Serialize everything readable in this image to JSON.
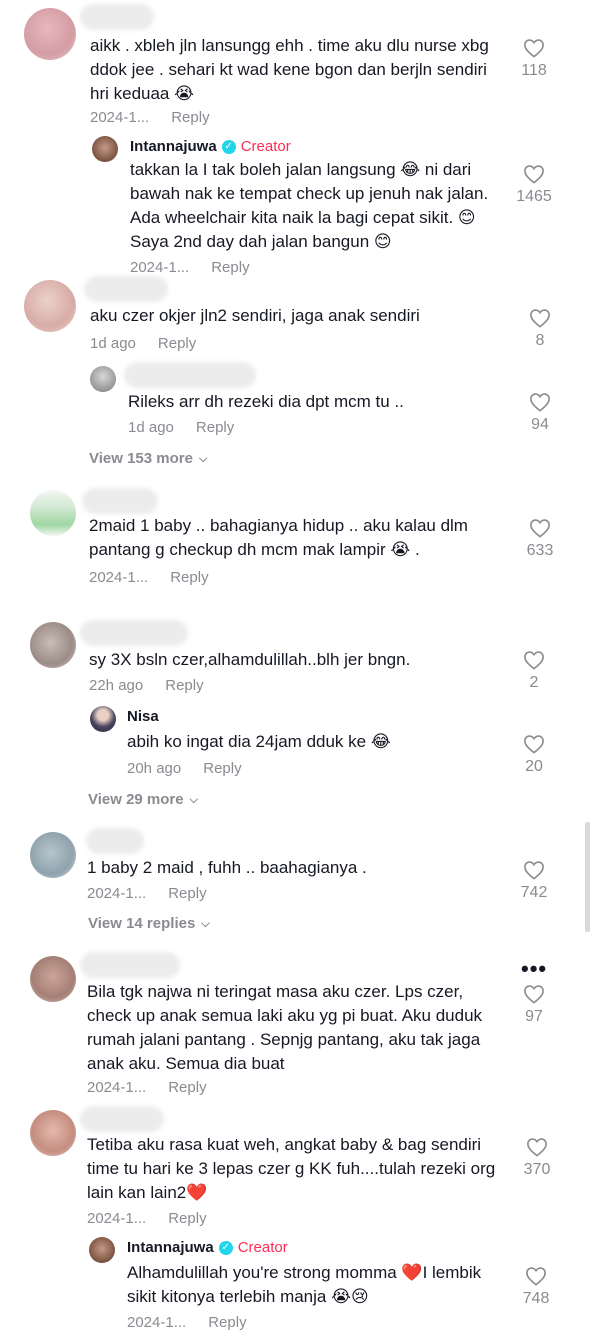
{
  "comments": [
    {
      "text": "aikk . xbleh jln lansungg ehh . time aku dlu nurse xbg ddok jee . sehari kt wad kene bgon dan berjln sendiri hri keduaa 😭",
      "date": "2024-1...",
      "reply": "Reply",
      "likes": "118"
    },
    {
      "name": "Intannajuwa",
      "creator": "Creator",
      "text": "takkan la I tak boleh jalan langsung 😂 ni dari bawah nak ke tempat check up jenuh nak jalan. Ada wheelchair kita naik la bagi cepat sikit. 😊 Saya 2nd day dah jalan bangun 😊",
      "date": "2024-1...",
      "reply": "Reply",
      "likes": "1465"
    },
    {
      "text": "aku czer okjer jln2 sendiri, jaga anak sendiri",
      "date": "1d ago",
      "reply": "Reply",
      "likes": "8"
    },
    {
      "text": "Rileks arr dh rezeki dia dpt mcm tu ..",
      "date": "1d ago",
      "reply": "Reply",
      "likes": "94"
    },
    {
      "text": "2maid 1 baby .. bahagianya hidup .. aku kalau dlm pantang g checkup dh mcm mak lampir 😭 .",
      "date": "2024-1...",
      "reply": "Reply",
      "likes": "633"
    },
    {
      "text": "sy 3X bsln czer,alhamdulillah..blh jer bngn.",
      "date": "22h ago",
      "reply": "Reply",
      "likes": "2"
    },
    {
      "name": "Nisa",
      "text": "abih ko ingat dia 24jam dduk ke 😂",
      "date": "20h ago",
      "reply": "Reply",
      "likes": "20"
    },
    {
      "text": "1 baby 2 maid , fuhh .. baahagianya .",
      "date": "2024-1...",
      "reply": "Reply",
      "likes": "742"
    },
    {
      "text": "Bila tgk najwa ni teringat masa aku czer. Lps czer, check up anak semua laki aku yg pi buat. Aku duduk rumah jalani pantang . Sepnjg pantang, aku tak jaga anak aku. Semua dia buat",
      "date": "2024-1...",
      "reply": "Reply",
      "likes": "97",
      "more": "•••"
    },
    {
      "text": "Tetiba aku rasa kuat weh, angkat baby & bag sendiri time tu hari ke 3 lepas czer g KK fuh....tulah rezeki org lain kan lain2❤️",
      "date": "2024-1...",
      "reply": "Reply",
      "likes": "370"
    },
    {
      "name": "Intannajuwa",
      "creator": "Creator",
      "text": "Alhamdulillah you're strong momma ❤️I lembik sikit kitonya terlebih manja 😭😢",
      "date": "2024-1...",
      "reply": "Reply",
      "likes": "748"
    }
  ],
  "view_more": [
    "View 153 more",
    "View 29 more",
    "View 14 replies"
  ],
  "icons": {
    "heart": "heart-outline-icon",
    "chevron": "chevron-down-icon",
    "verified": "verified-badge-icon"
  },
  "colors": {
    "creator": "#fe2c55",
    "badge": "#20d5ec",
    "meta": "#8a8b91"
  }
}
